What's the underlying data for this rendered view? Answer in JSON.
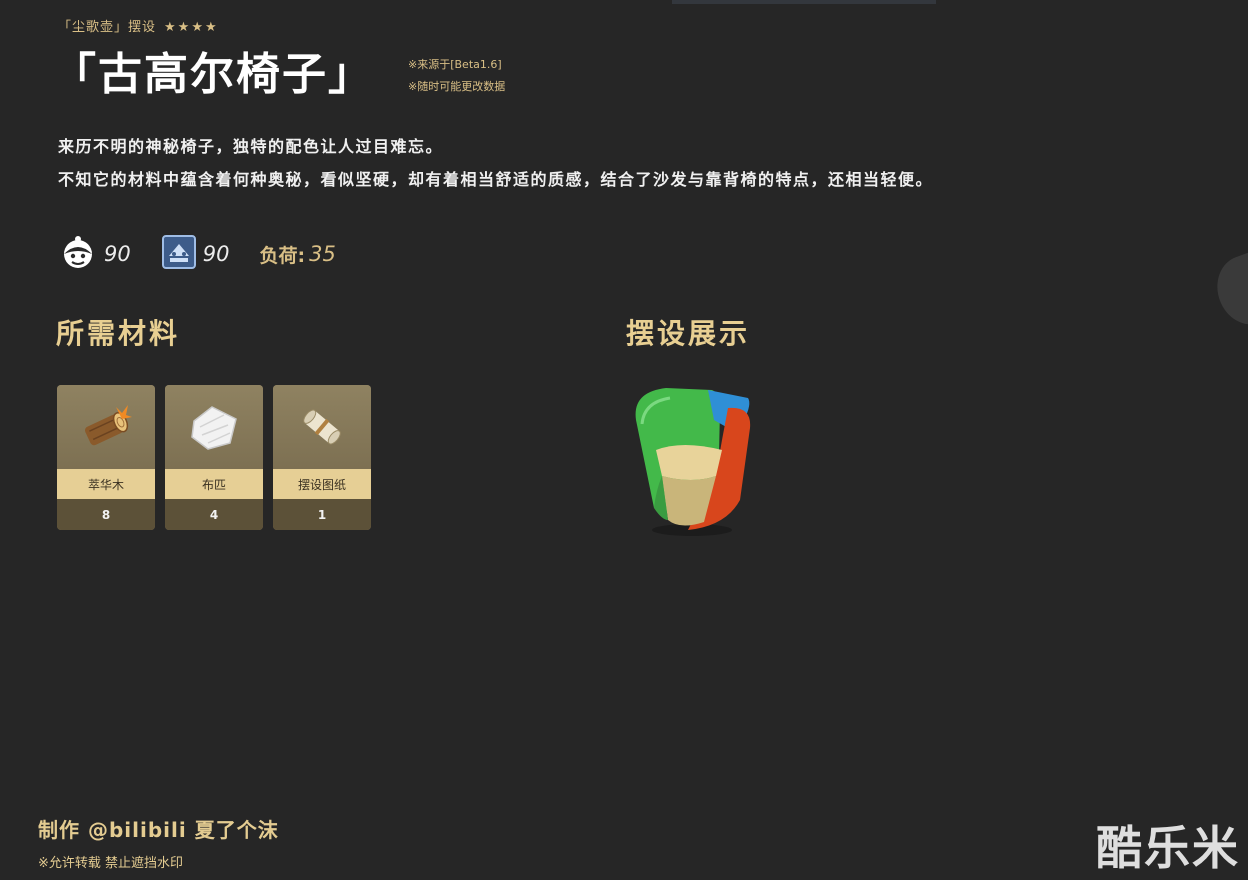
{
  "header": {
    "category": "「尘歌壶」摆设",
    "stars": "★★★★",
    "title": "「古高尔椅子」",
    "notes": [
      "※来源于[Beta1.6]",
      "※随时可能更改数据"
    ]
  },
  "description": [
    "来历不明的神秘椅子，独特的配色让人过目难忘。",
    "不知它的材料中蕴含着何种奥秘，看似坚硬，却有着相当舒适的质感，结合了沙发与靠背椅的特点，还相当轻便。"
  ],
  "stats": {
    "adeptal_energy": "90",
    "comfort": "90",
    "load_label": "负荷:",
    "load_value": "35",
    "icons": [
      "adeptal-energy-icon",
      "comfort-icon"
    ]
  },
  "sections": {
    "materials_title": "所需材料",
    "display_title": "摆设展示"
  },
  "materials": [
    {
      "name": "萃华木",
      "count": "8",
      "icon": "wood-log-icon"
    },
    {
      "name": "布匹",
      "count": "4",
      "icon": "cloth-icon"
    },
    {
      "name": "摆设图纸",
      "count": "1",
      "icon": "blueprint-scroll-icon"
    }
  ],
  "footer": {
    "credit": "制作 @bilibili 夏了个沫",
    "notice": "※允许转载 禁止遮挡水印",
    "watermark": "酷乐米"
  },
  "colors": {
    "background": "#262626",
    "gold": "#d9bf86",
    "card": "#8a7c5c",
    "card_label": "#e6cf95"
  }
}
